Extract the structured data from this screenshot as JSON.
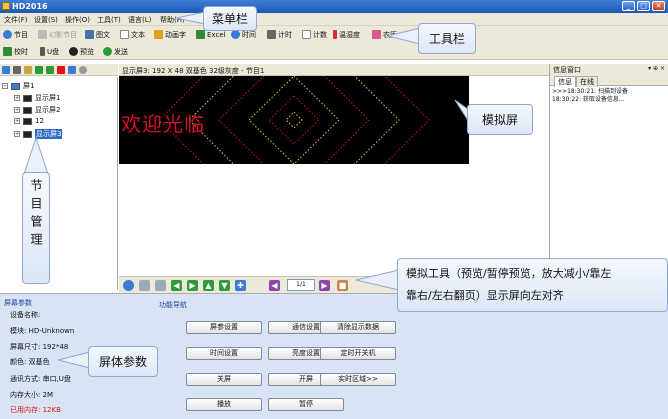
{
  "window": {
    "title": "HD2016",
    "controls": [
      "_",
      "□",
      "✕"
    ]
  },
  "menubar": {
    "items": [
      "文件(F)",
      "设置(S)",
      "操作(O)",
      "工具(T)",
      "语言(L)",
      "帮助(H)"
    ]
  },
  "toolbar": {
    "row1": [
      {
        "label": "节目",
        "icon": "program-icon",
        "color": "#3a7bd5"
      },
      {
        "label": "幻影节目",
        "icon": "phantom-program-icon",
        "color": "#9a9a9a",
        "disabled": true
      },
      {
        "label": "图文",
        "icon": "image-text-icon",
        "color": "#5a5a5a"
      },
      {
        "label": "文本",
        "icon": "text-icon",
        "color": "#ffffff"
      },
      {
        "label": "动画字",
        "icon": "animated-text-icon",
        "color": "#e0a020"
      },
      {
        "label": "Excel",
        "icon": "excel-icon",
        "color": "#2e8b3a"
      },
      {
        "label": "时间",
        "icon": "clock-icon",
        "color": "#3a7bd5"
      },
      {
        "label": "计时",
        "icon": "timer-icon",
        "color": "#5a5a5a"
      },
      {
        "label": "计数",
        "icon": "counter-icon",
        "color": "#ffffff"
      },
      {
        "label": "温湿度",
        "icon": "thermometer-icon",
        "color": "#cc3333"
      },
      {
        "label": "农历",
        "icon": "lunar-calendar-icon",
        "color": "#d85a8a"
      }
    ],
    "row2": [
      {
        "label": "校时",
        "icon": "sync-time-icon",
        "color": "#2e8b3a"
      },
      {
        "label": "U盘",
        "icon": "usb-icon",
        "color": "#5a5a5a"
      },
      {
        "label": "预览",
        "icon": "preview-icon",
        "color": "#222222"
      },
      {
        "label": "发送",
        "icon": "send-icon",
        "color": "#2e9b3a"
      }
    ]
  },
  "tree": {
    "root": "屏1",
    "screens": [
      "显示屏1",
      "显示屏2",
      "12",
      "显示屏3"
    ],
    "selected_index": 3
  },
  "simulator": {
    "status": "显示屏3: 192 X 48  双基色  32级灰度 - 节目1",
    "screen_text": "欢迎光临",
    "page": "1/1"
  },
  "info": {
    "title": "信息窗口",
    "controls": "▾ ⊕ ×",
    "tabs": [
      "信息",
      "在线"
    ],
    "log": [
      ">>>18:30:21: 扫描到设备",
      "18:30:22: 获取设备信息..."
    ]
  },
  "params": {
    "title": "屏幕参数",
    "rows": [
      "设备名称:",
      "模块: HD-Unknown",
      "屏幕尺寸: 192*48",
      "颜色: 双基色",
      "通讯方式: 串口,U盘",
      "内存大小: 2M",
      "已用内存: 12KB"
    ]
  },
  "funcnav": {
    "title": "功能导航",
    "buttons": [
      "屏参设置",
      "通信设置",
      "清除显示数据",
      "时间设置",
      "亮度设置",
      "定时开关机",
      "关屏",
      "开屏",
      "实时区域>>",
      "播放",
      "暂停"
    ]
  },
  "annotations": {
    "menubar": "菜单栏",
    "toolbar": "工具栏",
    "simscreen": "模拟屏",
    "program_mgmt": "节目管理",
    "params": "屏体参数",
    "simtools_line1": "模拟工具（预览/暂停预览，放大减小/靠左",
    "simtools_line2": "靠右/左右翻页）显示屏向左对齐"
  },
  "colors": {
    "titlebar": "#1b56b5",
    "led_red": "#d4102a",
    "led_yellow": "#e0d020",
    "panel_bg": "#d8e3f3",
    "toolbar_bg": "#ece9d8"
  }
}
